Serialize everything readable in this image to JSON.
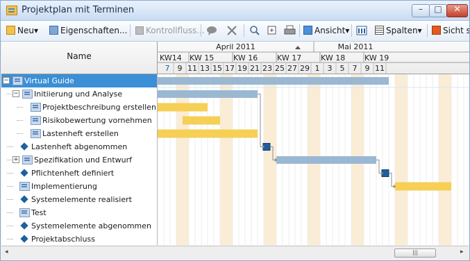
{
  "window": {
    "title": "Projektplan mit Terminen",
    "minimize_glyph": "–",
    "maximize_glyph": "□",
    "close_glyph": "✕"
  },
  "toolbar": {
    "new_label": "Neu",
    "properties_label": "Eigenschaften...",
    "control_flow_label": "Kontrollfluss...",
    "view_label": "Ansicht",
    "columns_label": "Spalten",
    "view_s_label": "Sicht s",
    "dropdown_glyph": "▾",
    "icons": [
      "new-icon",
      "properties-icon",
      "control-flow-icon",
      "comment-icon",
      "delete-icon",
      "zoom-icon",
      "zoom-fit-icon",
      "print-icon",
      "view-icon",
      "schedule-icon",
      "columns-icon",
      "save-view-icon"
    ]
  },
  "grid": {
    "name_header": "Name",
    "months": [
      {
        "label": "April 2011",
        "has_scroll_arrow": true
      },
      {
        "label": "Mai 2011"
      }
    ],
    "weeks": [
      "KW14",
      "KW 15",
      "KW 16",
      "KW 17",
      "KW 18",
      "KW 19"
    ],
    "days": [
      "7",
      "9",
      "11",
      "13",
      "15",
      "17",
      "19",
      "21",
      "23",
      "25",
      "27",
      "29",
      "1",
      "3",
      "5",
      "7",
      "9",
      "11"
    ],
    "rows": [
      {
        "label": "Virtual Guide",
        "level": 0,
        "kind": "summary",
        "expander": "−",
        "selected": true
      },
      {
        "label": "Initiierung und Analyse",
        "level": 1,
        "kind": "summary",
        "expander": "−"
      },
      {
        "label": "Projektbeschreibung erstellen",
        "level": 2,
        "kind": "task"
      },
      {
        "label": "Risikobewertung vornehmen",
        "level": 2,
        "kind": "task"
      },
      {
        "label": "Lastenheft erstellen",
        "level": 2,
        "kind": "task"
      },
      {
        "label": "Lastenheft abgenommen",
        "level": 1,
        "kind": "milestone"
      },
      {
        "label": "Spezifikation und Entwurf",
        "level": 1,
        "kind": "summary",
        "expander": "+"
      },
      {
        "label": "Pflichtenheft definiert",
        "level": 1,
        "kind": "milestone"
      },
      {
        "label": "Implementierung",
        "level": 1,
        "kind": "task"
      },
      {
        "label": "Systemelemente realisiert",
        "level": 1,
        "kind": "milestone"
      },
      {
        "label": "Test",
        "level": 1,
        "kind": "task"
      },
      {
        "label": "Systemelemente abgenommen",
        "level": 1,
        "kind": "milestone"
      },
      {
        "label": "Projektabschluss",
        "level": 1,
        "kind": "milestone"
      }
    ]
  },
  "gantt": {
    "start": "2011-04-06",
    "end": "2011-05-12",
    "colors": {
      "summary": "#9bb8d3",
      "task": "#f6cf55",
      "milestone": "#1f5fa0",
      "weekend": "#fbecd4",
      "connector": "#8c8c8c"
    },
    "bars": [
      {
        "row": 0,
        "type": "summary",
        "start": "2011-04-06",
        "end": "2011-05-12"
      },
      {
        "row": 1,
        "type": "summary",
        "start": "2011-04-06",
        "end": "2011-04-21"
      },
      {
        "row": 2,
        "type": "task",
        "start": "2011-04-06",
        "end": "2011-04-13"
      },
      {
        "row": 3,
        "type": "task",
        "start": "2011-04-10",
        "end": "2011-04-15"
      },
      {
        "row": 4,
        "type": "task",
        "start": "2011-04-06",
        "end": "2011-04-21"
      },
      {
        "row": 5,
        "type": "milestone",
        "date": "2011-04-23"
      },
      {
        "row": 6,
        "type": "summary",
        "start": "2011-04-25",
        "end": "2011-05-10"
      },
      {
        "row": 7,
        "type": "milestone",
        "date": "2011-05-12"
      },
      {
        "row": 8,
        "type": "task",
        "start": "2011-05-14",
        "end": "2011-05-22"
      }
    ]
  },
  "scrollbar": {
    "left_arrow": "◂",
    "right_arrow": "▸",
    "thumb_grip": "|||"
  }
}
